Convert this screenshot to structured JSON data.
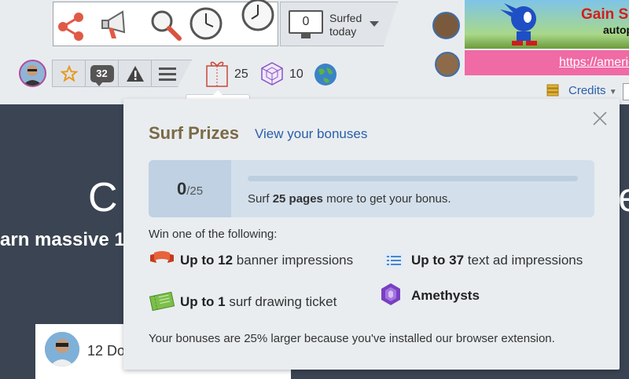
{
  "header": {
    "surfed_count": "0",
    "surfed_label_line1": "Surfed",
    "surfed_label_line2": "today",
    "notifications_count": "32",
    "prizes_count": "25",
    "amethyst_count": "10",
    "credits_label": "Credits",
    "ad_title": "Gain S",
    "ad_subtitle": "autop",
    "ad_link": "https://americ"
  },
  "tooltip": "Surf prizes",
  "hero": {
    "title_fragment_left": "C",
    "title_fragment_right": "e",
    "subtitle_fragment": "arn massive 1"
  },
  "card": {
    "name_fragment": "12 Do"
  },
  "popup": {
    "title": "Surf Prizes",
    "bonus_link": "View your bonuses",
    "progress": {
      "current": "0",
      "total": "/25",
      "fraction": 0,
      "msg_prefix": "Surf ",
      "msg_bold": "25 pages",
      "msg_suffix": " more to get your bonus."
    },
    "win_label": "Win one of the following:",
    "prizes": [
      {
        "bold": "Up to 12",
        "text": " banner impressions",
        "icon": "banner-icon"
      },
      {
        "bold": "Up to 37",
        "text": " text ad impressions",
        "icon": "text-ad-icon"
      },
      {
        "bold": "Up to 1",
        "text": " surf drawing ticket",
        "icon": "ticket-icon"
      },
      {
        "bold": "Amethysts",
        "text": "",
        "icon": "amethyst-icon"
      }
    ],
    "note": "Your bonuses are 25% larger because you've installed our browser extension."
  },
  "colors": {
    "title_brown": "#7a6a45",
    "link_blue": "#2a5fa8",
    "page_dark": "#3a4452"
  }
}
